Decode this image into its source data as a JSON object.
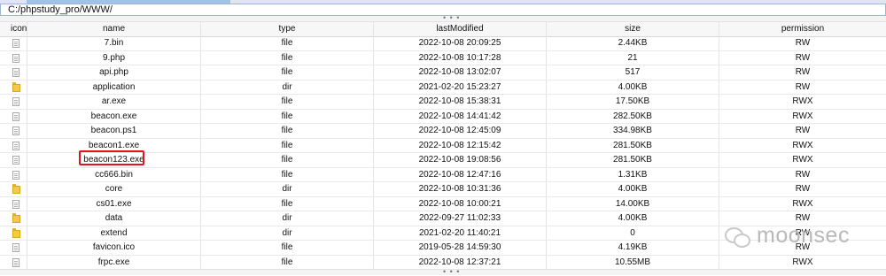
{
  "path": "C:/phpstudy_pro/WWW/",
  "splitter_grip": "• • •",
  "columns": {
    "icon": "icon",
    "name": "name",
    "type": "type",
    "lastModified": "lastModified",
    "size": "size",
    "permission": "permission"
  },
  "rows": [
    {
      "icon": "file-icon",
      "name": "7.bin",
      "type": "file",
      "lastModified": "2022-10-08 20:09:25",
      "size": "2.44KB",
      "permission": "RW"
    },
    {
      "icon": "file-icon",
      "name": "9.php",
      "type": "file",
      "lastModified": "2022-10-08 10:17:28",
      "size": "21",
      "permission": "RW"
    },
    {
      "icon": "file-icon",
      "name": "api.php",
      "type": "file",
      "lastModified": "2022-10-08 13:02:07",
      "size": "517",
      "permission": "RW"
    },
    {
      "icon": "folder-icon",
      "name": "application",
      "type": "dir",
      "lastModified": "2021-02-20 15:23:27",
      "size": "4.00KB",
      "permission": "RW"
    },
    {
      "icon": "file-icon",
      "name": "ar.exe",
      "type": "file",
      "lastModified": "2022-10-08 15:38:31",
      "size": "17.50KB",
      "permission": "RWX"
    },
    {
      "icon": "file-icon",
      "name": "beacon.exe",
      "type": "file",
      "lastModified": "2022-10-08 14:41:42",
      "size": "282.50KB",
      "permission": "RWX"
    },
    {
      "icon": "file-icon",
      "name": "beacon.ps1",
      "type": "file",
      "lastModified": "2022-10-08 12:45:09",
      "size": "334.98KB",
      "permission": "RW"
    },
    {
      "icon": "file-icon",
      "name": "beacon1.exe",
      "type": "file",
      "lastModified": "2022-10-08 12:15:42",
      "size": "281.50KB",
      "permission": "RWX"
    },
    {
      "icon": "file-icon",
      "name": "beacon123.exe",
      "type": "file",
      "lastModified": "2022-10-08 19:08:56",
      "size": "281.50KB",
      "permission": "RWX"
    },
    {
      "icon": "file-icon",
      "name": "cc666.bin",
      "type": "file",
      "lastModified": "2022-10-08 12:47:16",
      "size": "1.31KB",
      "permission": "RW"
    },
    {
      "icon": "folder-icon",
      "name": "core",
      "type": "dir",
      "lastModified": "2022-10-08 10:31:36",
      "size": "4.00KB",
      "permission": "RW"
    },
    {
      "icon": "file-icon",
      "name": "cs01.exe",
      "type": "file",
      "lastModified": "2022-10-08 10:00:21",
      "size": "14.00KB",
      "permission": "RWX"
    },
    {
      "icon": "folder-icon",
      "name": "data",
      "type": "dir",
      "lastModified": "2022-09-27 11:02:33",
      "size": "4.00KB",
      "permission": "RW"
    },
    {
      "icon": "folder-icon",
      "name": "extend",
      "type": "dir",
      "lastModified": "2021-02-20 11:40:21",
      "size": "0",
      "permission": "RW"
    },
    {
      "icon": "file-icon",
      "name": "favicon.ico",
      "type": "file",
      "lastModified": "2019-05-28 14:59:30",
      "size": "4.19KB",
      "permission": "RW"
    },
    {
      "icon": "file-icon",
      "name": "frpc.exe",
      "type": "file",
      "lastModified": "2022-10-08 12:37:21",
      "size": "10.55MB",
      "permission": "RWX"
    }
  ],
  "watermark": "moonsec",
  "colors": {
    "highlight": "#e3121b",
    "folder": "#f2c94c",
    "path_border": "#9fb7d6"
  }
}
